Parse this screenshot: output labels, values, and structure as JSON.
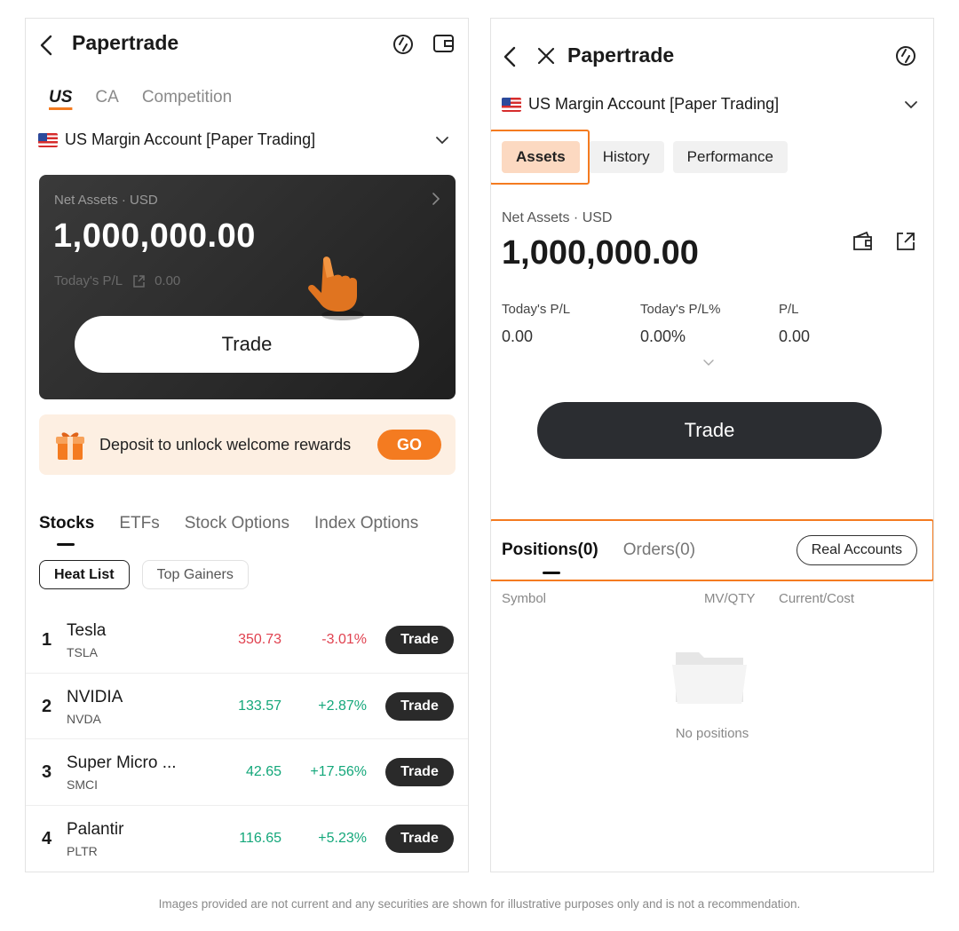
{
  "left": {
    "title": "Papertrade",
    "region_tabs": [
      "US",
      "CA",
      "Competition"
    ],
    "account_label": "US Margin Account [Paper Trading]",
    "card": {
      "net_assets_label": "Net Assets · USD",
      "net_assets_value": "1,000,000.00",
      "pl_label": "Today's P/L",
      "pl_value": "0.00",
      "trade_label": "Trade"
    },
    "promo": {
      "text": "Deposit to unlock welcome rewards",
      "button": "GO"
    },
    "stock_tabs": [
      "Stocks",
      "ETFs",
      "Stock Options",
      "Index Options"
    ],
    "chips": [
      "Heat List",
      "Top Gainers"
    ],
    "stocks": [
      {
        "rank": "1",
        "name": "Tesla",
        "ticker": "TSLA",
        "price": "350.73",
        "change": "-3.01%",
        "trend": "down",
        "trade": "Trade"
      },
      {
        "rank": "2",
        "name": "NVIDIA",
        "ticker": "NVDA",
        "price": "133.57",
        "change": "+2.87%",
        "trend": "up",
        "trade": "Trade"
      },
      {
        "rank": "3",
        "name": "Super Micro ...",
        "ticker": "SMCI",
        "price": "42.65",
        "change": "+17.56%",
        "trend": "up",
        "trade": "Trade"
      },
      {
        "rank": "4",
        "name": "Palantir",
        "ticker": "PLTR",
        "price": "116.65",
        "change": "+5.23%",
        "trend": "up",
        "trade": "Trade"
      }
    ]
  },
  "right": {
    "title": "Papertrade",
    "account_label": "US Margin Account [Paper Trading]",
    "segments": [
      "Assets",
      "History",
      "Performance"
    ],
    "net_assets_label": "Net Assets · USD",
    "net_assets_value": "1,000,000.00",
    "stats": [
      {
        "label": "Today's P/L",
        "value": "0.00"
      },
      {
        "label": "Today's P/L%",
        "value": "0.00%"
      },
      {
        "label": "P/L",
        "value": "0.00"
      }
    ],
    "trade_label": "Trade",
    "position_tabs": [
      "Positions(0)",
      "Orders(0)"
    ],
    "real_accounts": "Real Accounts",
    "columns": [
      "Symbol",
      "MV/QTY",
      "Current/Cost"
    ],
    "empty_text": "No positions"
  },
  "disclaimer": "Images provided are not current and any securities are shown for illustrative purposes only and is not a recommendation.",
  "colors": {
    "accent": "#f47b20",
    "up": "#13a77a",
    "down": "#e0414f",
    "dark": "#2b2d31"
  },
  "icons": [
    "back-icon",
    "close-icon",
    "refresh-icon",
    "wallet-icon",
    "chevron-down-icon",
    "chevron-right-icon",
    "share-icon",
    "gift-icon",
    "pointer-hand-icon",
    "folder-icon",
    "flag-us-icon"
  ]
}
